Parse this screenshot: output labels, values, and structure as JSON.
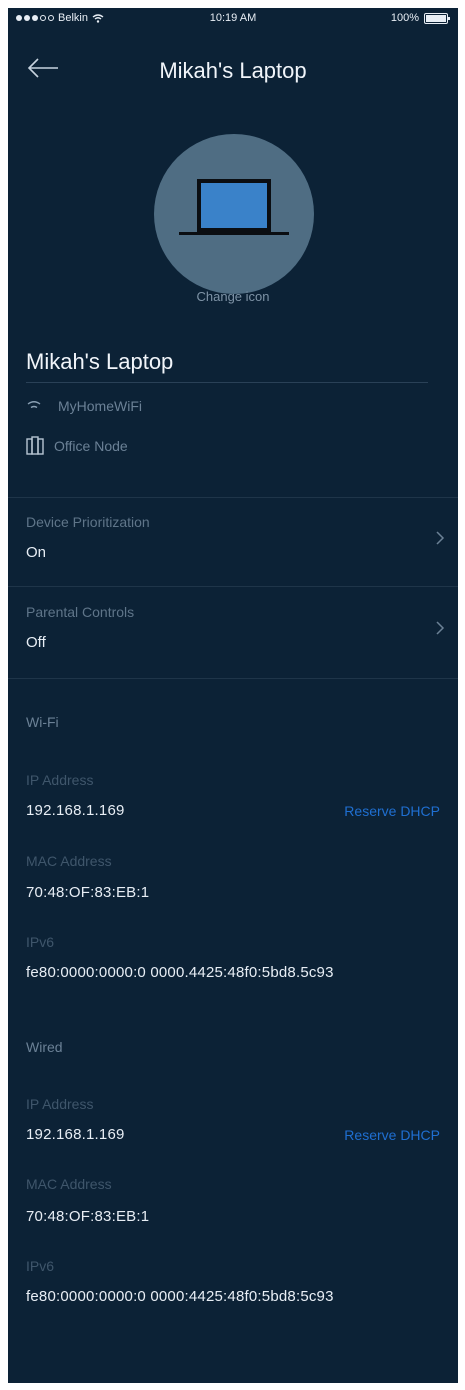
{
  "statusbar": {
    "carrier": "Belkin",
    "time": "10:19 AM",
    "battery": "100%"
  },
  "header": {
    "title": "Mikah's Laptop"
  },
  "device": {
    "change_icon_label": "Change icon",
    "name": "Mikah's Laptop",
    "wifi_network": "MyHomeWiFi",
    "node": "Office Node"
  },
  "settings": [
    {
      "label": "Device Prioritization",
      "value": "On"
    },
    {
      "label": "Parental Controls",
      "value": "Off"
    }
  ],
  "wifi": {
    "section": "Wi-Fi",
    "ip_label": "IP Address",
    "ip": "192.168.1.169",
    "reserve_label": "Reserve DHCP",
    "mac_label": "MAC Address",
    "mac": "70:48:OF:83:EB:1",
    "ipv6_label": "IPv6",
    "ipv6": "fe80:0000:0000:0 0000.4425:48f0:5bd8.5c93"
  },
  "wired": {
    "section": "Wired",
    "ip_label": "IP Address",
    "ip": "192.168.1.169",
    "reserve_label": "Reserve DHCP",
    "mac_label": "MAC Address",
    "mac": "70:48:OF:83:EB:1",
    "ipv6_label": "IPv6",
    "ipv6": "fe80:0000:0000:0 0000:4425:48f0:5bd8:5c93"
  },
  "colors": {
    "background": "#0c2236",
    "accent_link": "#1f6fd1",
    "icon_circle": "#4f6d83"
  },
  "icons": [
    "back-arrow-icon",
    "laptop-icon",
    "wifi-icon",
    "node-icon",
    "chevron-right-icon"
  ]
}
